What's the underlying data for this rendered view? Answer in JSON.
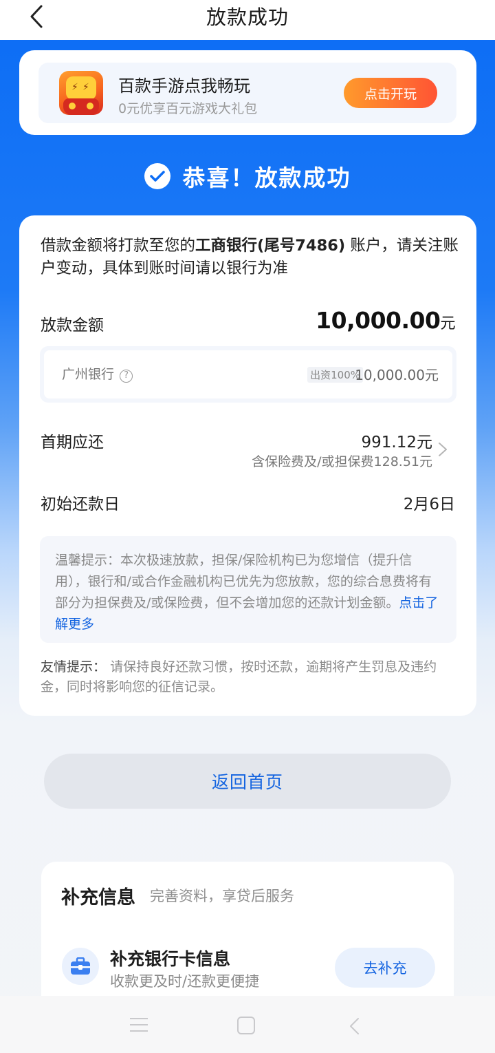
{
  "header": {
    "title": "放款成功"
  },
  "promo": {
    "title": "百款手游点我畅玩",
    "subtitle": "0元优享百元游戏大礼包",
    "button": "点击开玩"
  },
  "success": {
    "text": "恭喜！放款成功"
  },
  "loan": {
    "notice_pre": "借款金额将打款至您的",
    "notice_bank": "工商银行(尾号7486)",
    "notice_post": "账户，请关注账户变动，具体到账时间请以银行为准",
    "amount_label": "放款金额",
    "amount_value": "10,000.00",
    "amount_unit": "元",
    "lender_name": "广州银行",
    "lender_tag": "出资100%",
    "lender_amount": "10,000.00元",
    "first_label": "首期应还",
    "first_amount": "991.12元",
    "first_note": "含保险费及/或担保费128.51元",
    "start_label": "初始还款日",
    "start_value": "2月6日",
    "tip_text": "温馨提示：本次极速放款，担保/保险机构已为您增信（提升信用），银行和/或合作金融机构已优先为您放款，您的综合息费将有部分为担保费及/或保险费，但不会增加您的还款计划金额。",
    "tip_link": "点击了解更多",
    "friendly_label": "友情提示：",
    "friendly_text": "请保持良好还款习惯，按时还款，逾期将产生罚息及违约金，同时将影响您的征信记录。"
  },
  "home_button": "返回首页",
  "supplement": {
    "title": "补充信息",
    "subtitle": "完善资料，享贷后服务",
    "item_title": "补充银行卡信息",
    "item_subtitle": "收款更及时/还款更便捷",
    "item_button": "去补充"
  },
  "colors": {
    "brand_blue": "#0b6cf5",
    "link_blue": "#1464e0",
    "promo_orange": "#ff5434"
  }
}
